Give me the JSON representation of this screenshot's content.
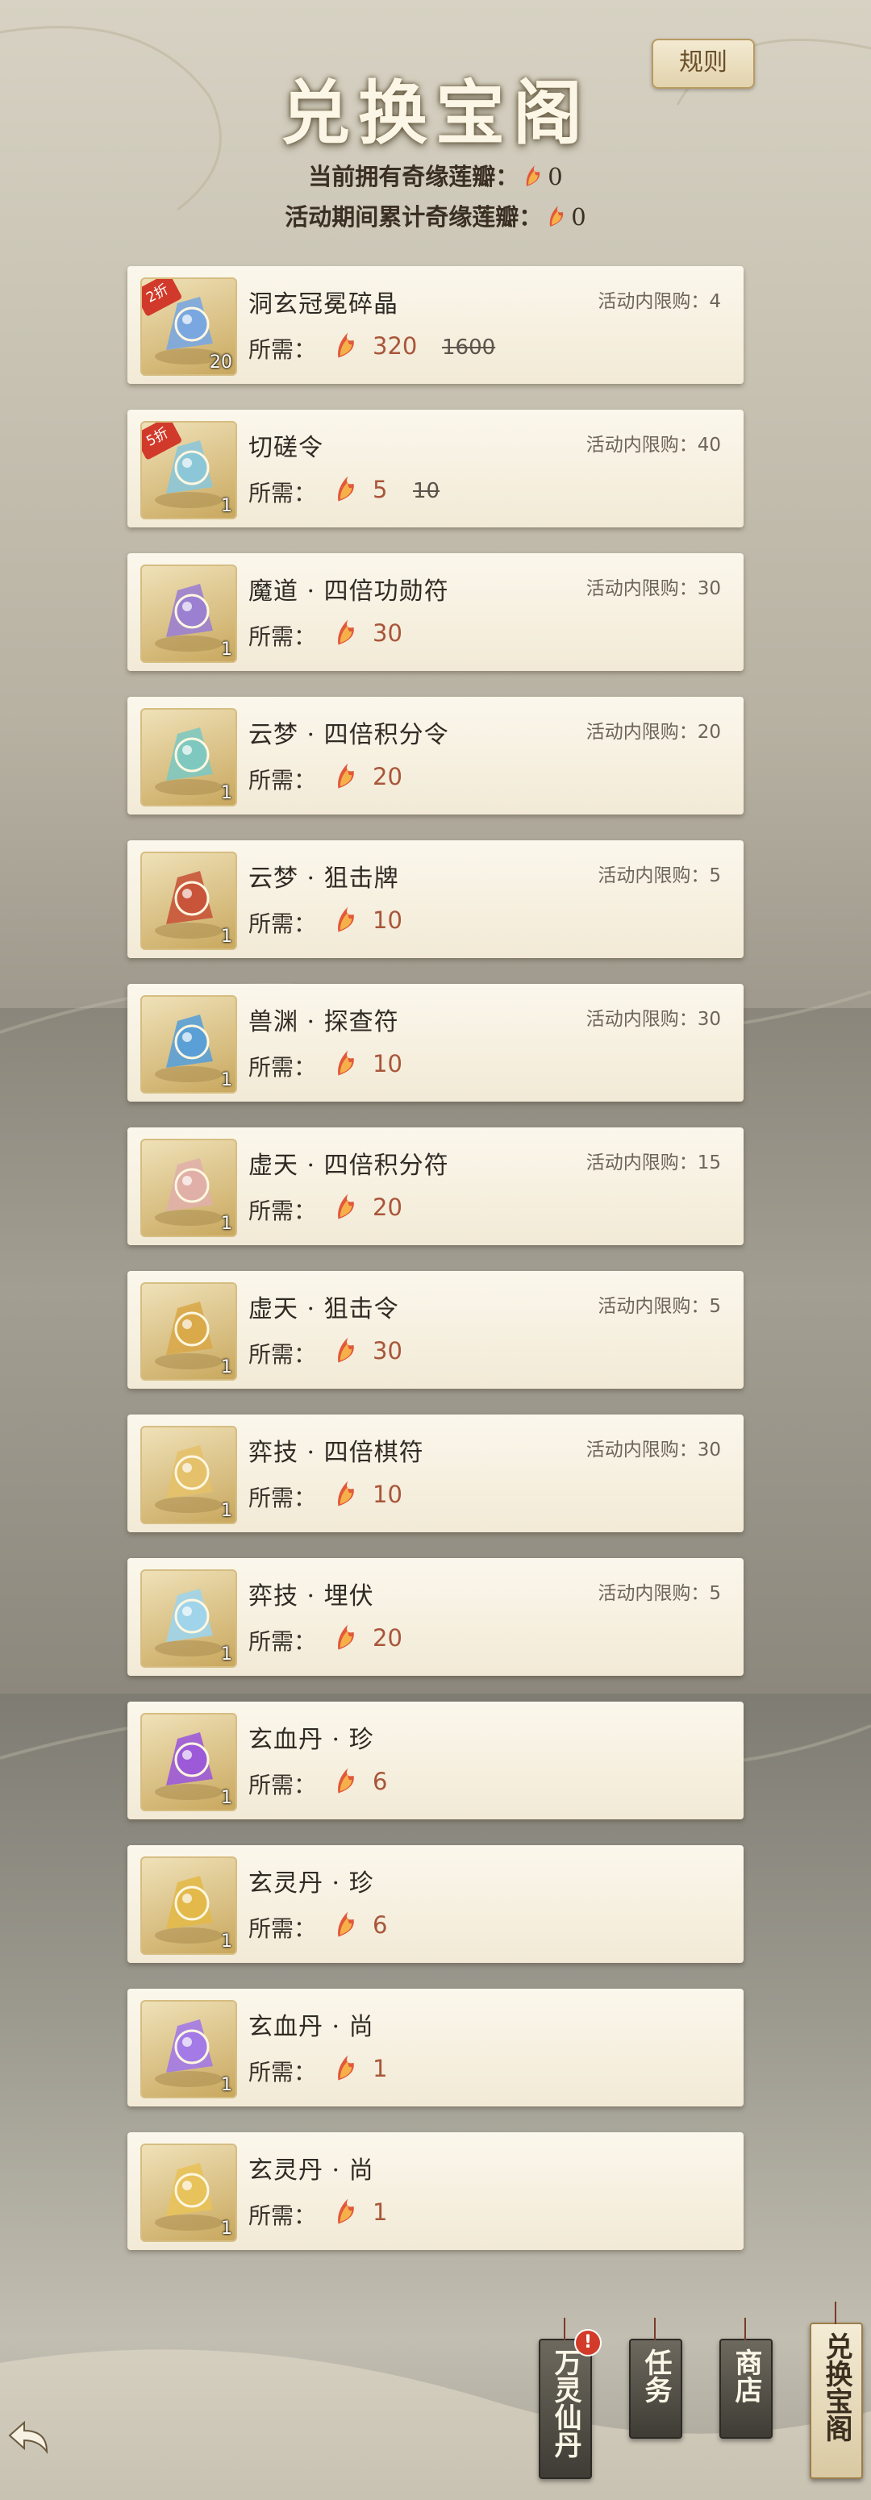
{
  "header": {
    "title": "兑换宝阁",
    "rules_label": "规则",
    "owned_label": "当前拥有奇缘莲瓣：",
    "owned_value": "0",
    "accum_label": "活动期间累计奇缘莲瓣：",
    "accum_value": "0"
  },
  "common": {
    "need_label": "所需："
  },
  "items": [
    {
      "name": "洞玄冠冕碎晶",
      "limit": "活动内限购：4",
      "price": "320",
      "orig": "1600",
      "qty": "20",
      "discount": "2折",
      "icon": "crystal-shard-icon",
      "color": "#7aa7e0"
    },
    {
      "name": "切磋令",
      "limit": "活动内限购：40",
      "price": "5",
      "orig": "10",
      "qty": "1",
      "discount": "5折",
      "icon": "scroll-token-icon",
      "color": "#8cc7d8"
    },
    {
      "name": "魔道 · 四倍功勋符",
      "limit": "活动内限购：30",
      "price": "30",
      "orig": "",
      "qty": "1",
      "discount": "",
      "icon": "purple-talisman-icon",
      "color": "#9b7fd0"
    },
    {
      "name": "云梦 · 四倍积分令",
      "limit": "活动内限购：20",
      "price": "20",
      "orig": "",
      "qty": "1",
      "discount": "",
      "icon": "fan-cards-icon",
      "color": "#7fc8c0"
    },
    {
      "name": "云梦 · 狙击牌",
      "limit": "活动内限购：5",
      "price": "10",
      "orig": "",
      "qty": "1",
      "discount": "",
      "icon": "red-dagger-icon",
      "color": "#c8553a"
    },
    {
      "name": "兽渊 · 探查符",
      "limit": "活动内限购：30",
      "price": "10",
      "orig": "",
      "qty": "1",
      "discount": "",
      "icon": "blue-talisman-icon",
      "color": "#5aa0d6"
    },
    {
      "name": "虚天 · 四倍积分符",
      "limit": "活动内限购：15",
      "price": "20",
      "orig": "",
      "qty": "1",
      "discount": "",
      "icon": "scroll-bundle-icon",
      "color": "#e0b0a8"
    },
    {
      "name": "虚天 · 狙击令",
      "limit": "活动内限购：5",
      "price": "30",
      "orig": "",
      "qty": "1",
      "discount": "",
      "icon": "gold-blade-icon",
      "color": "#d9a94a"
    },
    {
      "name": "弈技 · 四倍棋符",
      "limit": "活动内限购：30",
      "price": "10",
      "orig": "",
      "qty": "1",
      "discount": "",
      "icon": "go-stone-icon",
      "color": "#e4c16a"
    },
    {
      "name": "弈技 · 埋伏",
      "limit": "活动内限购：5",
      "price": "20",
      "orig": "",
      "qty": "1",
      "discount": "",
      "icon": "lotus-figure-icon",
      "color": "#9fd4ea"
    },
    {
      "name": "玄血丹 · 珍",
      "limit": "",
      "price": "6",
      "orig": "",
      "qty": "1",
      "discount": "",
      "icon": "purple-orb-box-icon",
      "color": "#9c5ad8"
    },
    {
      "name": "玄灵丹 · 珍",
      "limit": "",
      "price": "6",
      "orig": "",
      "qty": "1",
      "discount": "",
      "icon": "gold-orb-box-icon",
      "color": "#e2b94a"
    },
    {
      "name": "玄血丹 · 尚",
      "limit": "",
      "price": "1",
      "orig": "",
      "qty": "1",
      "discount": "",
      "icon": "purple-orb-stand-icon",
      "color": "#a37ae6"
    },
    {
      "name": "玄灵丹 · 尚",
      "limit": "",
      "price": "1",
      "orig": "",
      "qty": "1",
      "discount": "",
      "icon": "gold-orb-stand-icon",
      "color": "#e8c25a"
    }
  ],
  "nav": [
    {
      "label": "万灵仙丹",
      "badge": "!",
      "active": false
    },
    {
      "label": "任务",
      "badge": "",
      "active": false
    },
    {
      "label": "商店",
      "badge": "",
      "active": false
    },
    {
      "label": "兑换宝阁",
      "badge": "",
      "active": true
    }
  ]
}
